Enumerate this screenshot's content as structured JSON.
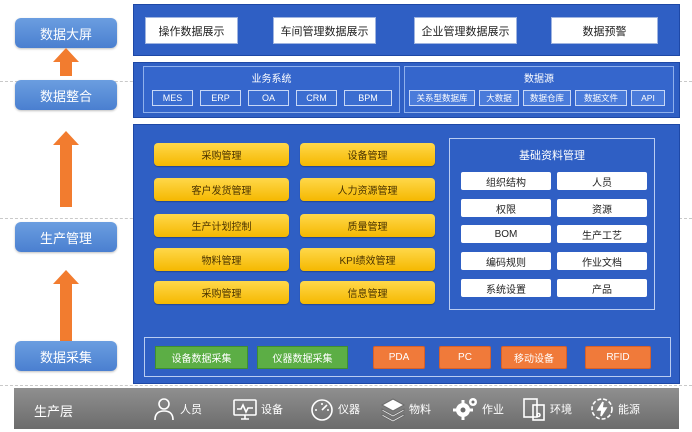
{
  "stages": {
    "screen": "数据大屏",
    "integration": "数据整合",
    "production_mgmt": "生产管理",
    "collection": "数据采集"
  },
  "screen_layer": {
    "items": [
      "操作数据展示",
      "车间管理数据展示",
      "企业管理数据展示",
      "数据预警"
    ]
  },
  "integration_layer": {
    "business_title": "业务系统",
    "business_items": [
      "MES",
      "ERP",
      "OA",
      "CRM",
      "BPM"
    ],
    "datasource_title": "数据源",
    "datasource_items": [
      "关系型数据库",
      "大数据",
      "数据仓库",
      "数据文件",
      "API"
    ]
  },
  "production_layer": {
    "left_modules": [
      "采购管理",
      "客户发货管理",
      "生产计划控制",
      "物料管理",
      "采购管理"
    ],
    "right_modules": [
      "设备管理",
      "人力资源管理",
      "质量管理",
      "KPI绩效管理",
      "信息管理"
    ],
    "base_title": "基础资料管理",
    "base_items": [
      "组织结构",
      "人员",
      "权限",
      "资源",
      "BOM",
      "生产工艺",
      "编码规则",
      "作业文档",
      "系统设置",
      "产品"
    ]
  },
  "collection_layer": {
    "green_items": [
      "设备数据采集",
      "仪器数据采集"
    ],
    "orange_items": [
      "PDA",
      "PC",
      "移动设备",
      "RFID"
    ]
  },
  "bottom": {
    "label": "生产层",
    "items": [
      {
        "label": "人员",
        "icon": "person-icon"
      },
      {
        "label": "设备",
        "icon": "monitor-icon"
      },
      {
        "label": "仪器",
        "icon": "gauge-icon"
      },
      {
        "label": "物料",
        "icon": "layers-icon"
      },
      {
        "label": "作业",
        "icon": "gears-icon"
      },
      {
        "label": "环境",
        "icon": "devices-icon"
      },
      {
        "label": "能源",
        "icon": "energy-icon"
      }
    ]
  },
  "colors": {
    "panel": "#2f5fc4",
    "stage": "#5b8fdc",
    "arrow": "#f27c2f",
    "yellow": "#f5c000",
    "green": "#5cae45",
    "orange": "#f07a3a",
    "bottom": "#7f7f7f"
  }
}
